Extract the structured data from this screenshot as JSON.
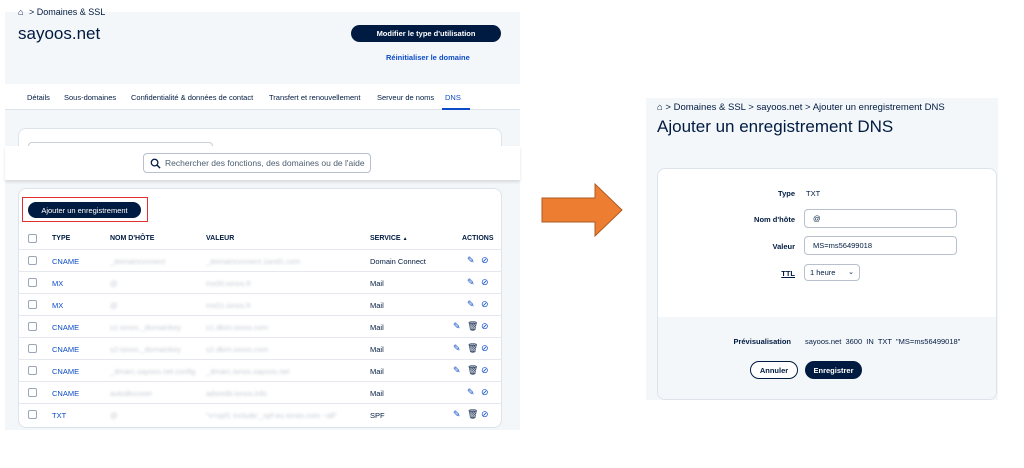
{
  "left": {
    "breadcrumb": "Domaines & SSL",
    "domain": "sayoos.net",
    "modify_button": "Modifier le type d'utilisation",
    "reset_link": "Réinitialiser le domaine",
    "tabs": [
      "Détails",
      "Sous-domaines",
      "Confidentialité & données de contact",
      "Transfert et renouvellement",
      "Serveur de noms",
      "DNS"
    ],
    "active_tab": "DNS",
    "search_placeholder": "Rechercher des fonctions, des domaines ou de l'aide",
    "add_button": "Ajouter un enregistrement",
    "columns": {
      "type": "TYPE",
      "host": "NOM D'HÔTE",
      "value": "VALEUR",
      "service": "SERVICE",
      "sort": "▲",
      "actions": "ACTIONS"
    },
    "rows": [
      {
        "type": "CNAME",
        "host": "_domainconnect",
        "value": "_domainconnect.1and1.com",
        "service": "Domain Connect"
      },
      {
        "type": "MX",
        "host": "@",
        "value": "mx00.ionos.fr",
        "service": "Mail"
      },
      {
        "type": "MX",
        "host": "@",
        "value": "mx01.ionos.fr",
        "service": "Mail"
      },
      {
        "type": "CNAME",
        "host": "s1-ionos._domainkey",
        "value": "s1.dkim.ionos.com",
        "service": "Mail"
      },
      {
        "type": "CNAME",
        "host": "s2-ionos._domainkey",
        "value": "s2.dkim.ionos.com",
        "service": "Mail"
      },
      {
        "type": "CNAME",
        "host": "_dmarc.sayoos.net.config",
        "value": "_dmarc.ionos.sayoos.net",
        "service": "Mail"
      },
      {
        "type": "CNAME",
        "host": "autodiscover",
        "value": "adsredir.ionos.info",
        "service": "Mail"
      },
      {
        "type": "TXT",
        "host": "@",
        "value": "\"v=spf1 include:_spf-eu.ionos.com ~all\"",
        "service": "SPF"
      }
    ]
  },
  "right": {
    "breadcrumb": [
      "Domaines & SSL",
      "sayoos.net",
      "Ajouter un enregistrement DNS"
    ],
    "title": "Ajouter un enregistrement DNS",
    "type_label": "Type",
    "type_value": "TXT",
    "host_label": "Nom d'hôte",
    "host_value": "@",
    "value_label": "Valeur",
    "value_value": "MS=ms56499018",
    "ttl_label": "TTL",
    "ttl_value": "1 heure",
    "preview_label": "Prévisualisation",
    "preview_value": "sayoos.net  3600  IN  TXT  \"MS=ms56499018\"",
    "cancel_button": "Annuler",
    "save_button": "Enregistrer"
  },
  "colors": {
    "navy": "#001b41",
    "link_blue": "#0b4bc7",
    "arrow_orange": "#ed7d31",
    "highlight_red": "#e0312f",
    "panel_bg": "#f4f7fa"
  },
  "icons": [
    "home-icon",
    "search-icon",
    "pencil-icon",
    "trash-icon",
    "block-icon",
    "chevron-down-icon",
    "arrow-right-icon"
  ]
}
